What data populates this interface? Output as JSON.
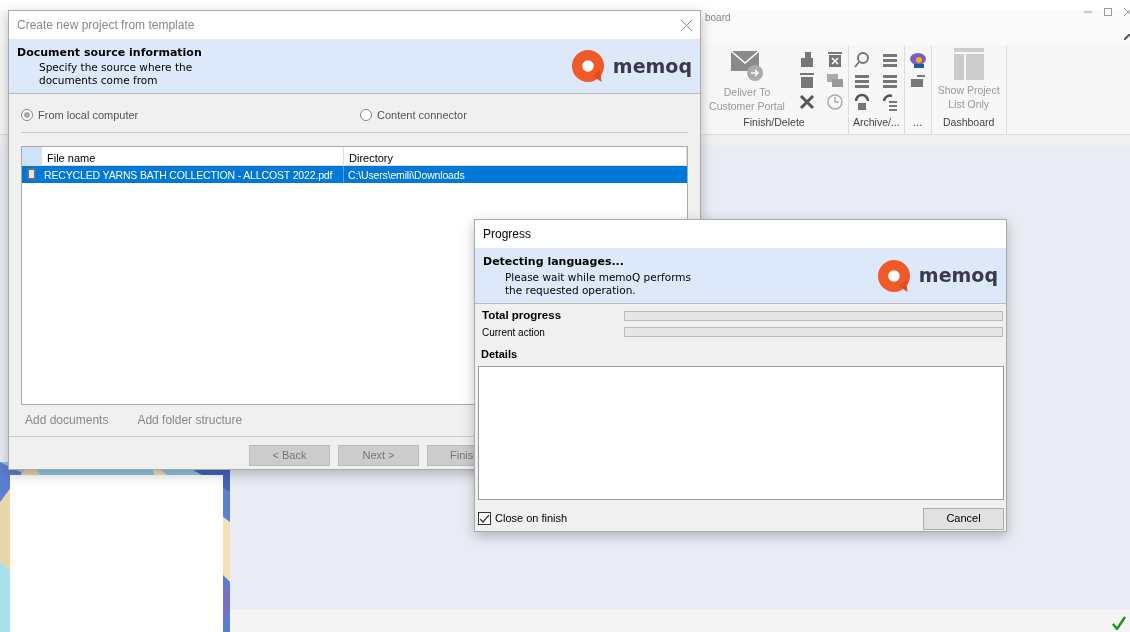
{
  "background_window": {
    "title": "board",
    "ribbon": [
      {
        "label": "Finish/Delete",
        "large_button": "Deliver To Customer Portal"
      },
      {
        "label": "Archive/..."
      },
      {
        "label": "..."
      },
      {
        "label": "Dashboard",
        "large_button": "Show Project List Only"
      }
    ]
  },
  "template_dialog": {
    "title": "Create new project from template",
    "header": {
      "title": "Document source information",
      "subtitle_lines": [
        "Specify the source where the",
        "documents come from"
      ],
      "logo": "memoq"
    },
    "sources": [
      {
        "label": "From local computer",
        "selected": true
      },
      {
        "label": "Content connector",
        "selected": false
      }
    ],
    "table": {
      "columns": [
        "File name",
        "Directory"
      ],
      "rows": [
        {
          "file_name": "RECYCLED YARNS BATH COLLECTION - ALLCOST 2022.pdf",
          "directory": "C:\\Users\\emili\\Downloads",
          "selected": true
        }
      ]
    },
    "links": [
      "Add documents",
      "Add folder structure"
    ],
    "buttons": [
      "< Back",
      "Next >",
      "Finis"
    ]
  },
  "progress_dialog": {
    "title": "Progress",
    "header": {
      "title": "Detecting languages...",
      "subtitle_lines": [
        "Please wait while memoQ performs",
        "the requested operation."
      ],
      "logo": "memoq"
    },
    "bars": [
      {
        "label": "Total progress",
        "level": 0
      },
      {
        "label": "Current action",
        "level": 0
      }
    ],
    "details_label": "Details",
    "close_on_finish": {
      "label": "Close on finish",
      "checked": true
    },
    "cancel_button": "Cancel"
  }
}
